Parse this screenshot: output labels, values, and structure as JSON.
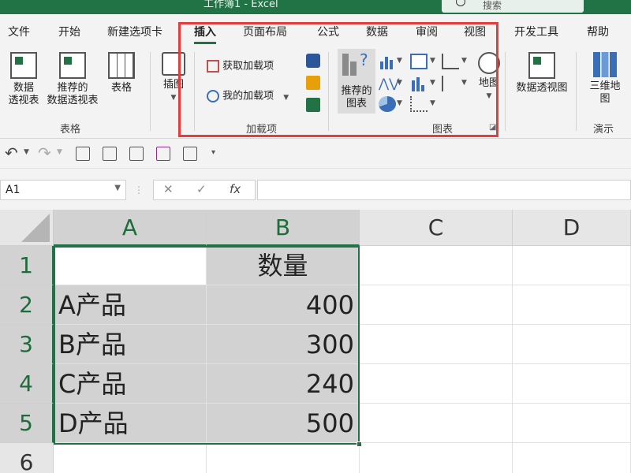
{
  "window": {
    "title": "工作簿1 - Excel",
    "search_placeholder": "搜索"
  },
  "ribbon_tabs": [
    "文件",
    "开始",
    "新建选项卡",
    "插入",
    "页面布局",
    "公式",
    "数据",
    "审阅",
    "视图",
    "开发工具",
    "帮助"
  ],
  "active_tab": "插入",
  "groups": {
    "tables": {
      "label": "表格",
      "pivot_table": "数据\n透视表",
      "recommended_pivot": "推荐的\n数据透视表",
      "table": "表格"
    },
    "illustrations": {
      "label": "插图"
    },
    "addins": {
      "label": "加载项",
      "get_addins": "获取加载项",
      "my_addins": "我的加载项"
    },
    "charts": {
      "label": "图表",
      "recommended_charts": "推荐的\n图表",
      "maps": "地图",
      "pivot_chart": "数据透视图"
    },
    "tours": {
      "label": "演示",
      "map3d": "三维地\n图"
    }
  },
  "name_box": "A1",
  "formula_symbol": "fx",
  "columns": [
    "A",
    "B",
    "C",
    "D"
  ],
  "rows": [
    "1",
    "2",
    "3",
    "4",
    "5",
    "6"
  ],
  "cells": {
    "B1": "数量",
    "A2": "A产品",
    "B2": "400",
    "A3": "B产品",
    "B3": "300",
    "A4": "C产品",
    "B4": "240",
    "A5": "D产品",
    "B5": "500"
  },
  "accent_color": "#217346",
  "highlight_color": "#e53c3c"
}
